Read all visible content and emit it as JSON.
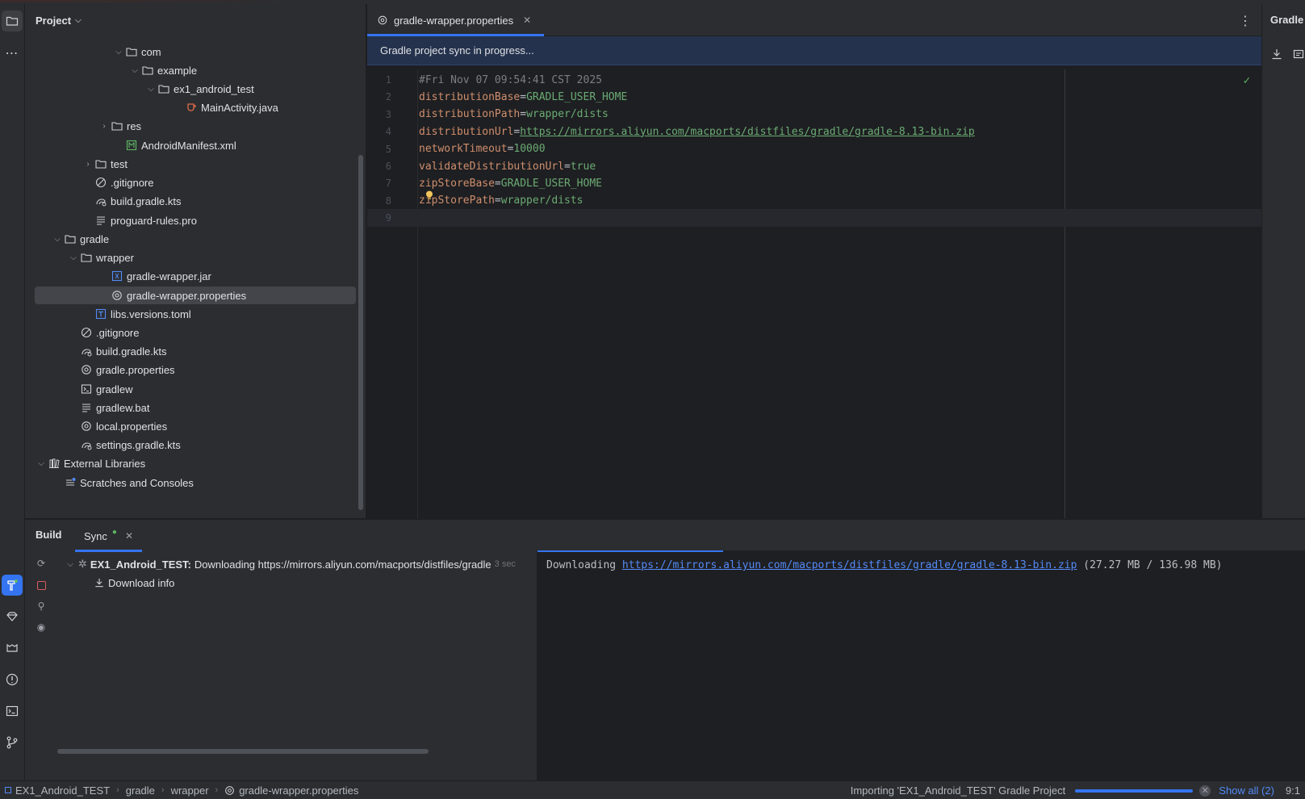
{
  "project_panel": {
    "title": "Project",
    "tree": [
      {
        "label": "com",
        "icon": "folder-icon",
        "expanded": true,
        "kind": "folder"
      },
      {
        "label": "example",
        "icon": "folder-icon",
        "expanded": true,
        "kind": "folder"
      },
      {
        "label": "ex1_android_test",
        "icon": "folder-icon",
        "expanded": true,
        "kind": "folder"
      },
      {
        "label": "MainActivity.java",
        "icon": "java-file-icon",
        "kind": "file"
      },
      {
        "label": "res",
        "icon": "folder-icon",
        "expanded": false,
        "kind": "folder"
      },
      {
        "label": "AndroidManifest.xml",
        "icon": "manifest-file-icon",
        "kind": "file"
      },
      {
        "label": "test",
        "icon": "folder-icon",
        "expanded": false,
        "kind": "folder"
      },
      {
        "label": ".gitignore",
        "icon": "ignore-file-icon",
        "kind": "file"
      },
      {
        "label": "build.gradle.kts",
        "icon": "gradle-file-icon",
        "kind": "file"
      },
      {
        "label": "proguard-rules.pro",
        "icon": "text-file-icon",
        "kind": "file"
      },
      {
        "label": "gradle",
        "icon": "folder-icon",
        "expanded": true,
        "kind": "folder"
      },
      {
        "label": "wrapper",
        "icon": "folder-icon",
        "expanded": true,
        "kind": "folder"
      },
      {
        "label": "gradle-wrapper.jar",
        "icon": "jar-file-icon",
        "kind": "file"
      },
      {
        "label": "gradle-wrapper.properties",
        "icon": "properties-file-icon",
        "kind": "file",
        "selected": true
      },
      {
        "label": "libs.versions.toml",
        "icon": "toml-file-icon",
        "kind": "file"
      },
      {
        "label": ".gitignore",
        "icon": "ignore-file-icon",
        "kind": "file"
      },
      {
        "label": "build.gradle.kts",
        "icon": "gradle-file-icon",
        "kind": "file"
      },
      {
        "label": "gradle.properties",
        "icon": "properties-file-icon",
        "kind": "file"
      },
      {
        "label": "gradlew",
        "icon": "shell-file-icon",
        "kind": "file"
      },
      {
        "label": "gradlew.bat",
        "icon": "text-file-icon",
        "kind": "file"
      },
      {
        "label": "local.properties",
        "icon": "properties-file-icon",
        "kind": "file"
      },
      {
        "label": "settings.gradle.kts",
        "icon": "gradle-file-icon",
        "kind": "file"
      },
      {
        "label": "External Libraries",
        "icon": "library-icon",
        "expanded": true,
        "kind": "folder"
      },
      {
        "label": "Scratches and Consoles",
        "icon": "scratches-icon",
        "kind": "file"
      }
    ]
  },
  "editor": {
    "tab_label": "gradle-wrapper.properties",
    "banner": "Gradle project sync in progress...",
    "lines": [
      {
        "n": "1",
        "key": "#Fri Nov 07 09:54:41 CST 2025",
        "eq": "",
        "val": "",
        "type": "comment"
      },
      {
        "n": "2",
        "key": "distributionBase",
        "eq": "=",
        "val": "GRADLE_USER_HOME",
        "type": "kv"
      },
      {
        "n": "3",
        "key": "distributionPath",
        "eq": "=",
        "val": "wrapper/dists",
        "type": "kv"
      },
      {
        "n": "4",
        "key": "distributionUrl",
        "eq": "=",
        "val": "https://mirrors.aliyun.com/macports/distfiles/gradle/gradle-8.13-bin.zip",
        "type": "url"
      },
      {
        "n": "5",
        "key": "networkTimeout",
        "eq": "=",
        "val": "10000",
        "type": "kv"
      },
      {
        "n": "6",
        "key": "validateDistributionUrl",
        "eq": "=",
        "val": "true",
        "type": "kv"
      },
      {
        "n": "7",
        "key": "zipStoreBase",
        "eq": "=",
        "val": "GRADLE_USER_HOME",
        "type": "kv"
      },
      {
        "n": "8",
        "key": "zipStorePath",
        "eq": "=",
        "val": "wrapper/dists",
        "type": "kv"
      },
      {
        "n": "9",
        "key": "",
        "eq": "",
        "val": "",
        "type": "empty"
      }
    ]
  },
  "right_panel": {
    "title": "Gradle"
  },
  "build_panel": {
    "title": "Build",
    "sync_tab": "Sync",
    "task_name": "EX1_Android_TEST:",
    "task_message": "Downloading https://mirrors.aliyun.com/macports/distfiles/gradle",
    "task_time": "3 sec",
    "child_label": "Download info",
    "console_prefix": "Downloading ",
    "console_link": "https://mirrors.aliyun.com/macports/distfiles/gradle/gradle-8.13-bin.zip",
    "console_suffix": " (27.27 MB / 136.98 MB)"
  },
  "status_bar": {
    "breadcrumbs": [
      "EX1_Android_TEST",
      "gradle",
      "wrapper",
      "gradle-wrapper.properties"
    ],
    "task": "Importing 'EX1_Android_TEST' Gradle Project",
    "show_all": "Show all (2)",
    "position": "9:1"
  },
  "colors": {
    "accent": "#3574f0",
    "keyword": "#cf8e6d",
    "value": "#6aab73",
    "comment": "#7a7e85"
  }
}
